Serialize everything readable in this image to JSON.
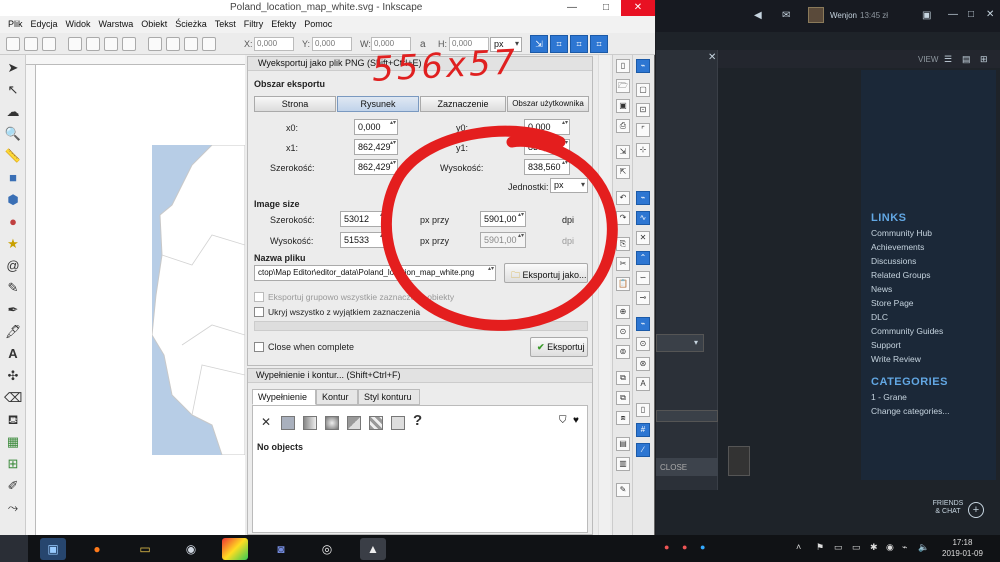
{
  "inkscape": {
    "title": "Poland_location_map_white.svg - Inkscape",
    "window_controls": [
      "—",
      "□",
      "✕"
    ],
    "menu": [
      "Plik",
      "Edycja",
      "Widok",
      "Warstwa",
      "Obiekt",
      "Ścieżka",
      "Tekst",
      "Filtry",
      "Efekty",
      "Pomoc"
    ],
    "toolbar": {
      "x_label": "X:",
      "x_value": "0,000",
      "y_label": "Y:",
      "y_value": "0,000",
      "w_label": "W:",
      "w_value": "0,000",
      "h_label": "H:",
      "h_value": "0,000",
      "lock_icon": "lock-icon",
      "unit": "px"
    }
  },
  "export_dialog": {
    "header": "Wyeksportuj jako plik PNG (Shift+Ctrl+E)",
    "area_title": "Obszar eksportu",
    "area_buttons": [
      "Strona",
      "Rysunek",
      "Zaznaczenie",
      "Obszar użytkownika"
    ],
    "active_area": "Rysunek",
    "x0_label": "x0:",
    "x0_value": "0,000",
    "y0_label": "y0:",
    "y0_value": "0,000",
    "x1_label": "x1:",
    "x1_value": "862,429",
    "y1_label": "y1:",
    "y1_value": "838,560",
    "width_label": "Szerokość:",
    "width_value": "862,429",
    "height_label": "Wysokość:",
    "height_value": "838,560",
    "units_label": "Jednostki:",
    "units_value": "px",
    "image_size_title": "Image size",
    "img_width_label": "Szerokość:",
    "img_width_value": "53012",
    "img_height_label": "Wysokość:",
    "img_height_value": "51533",
    "px_at_1": "px przy",
    "dpi_1_value": "5901,00",
    "dpi_1_label": "dpi",
    "px_at_2": "px przy",
    "dpi_2_value": "5901,00",
    "dpi_2_label": "dpi",
    "filename_title": "Nazwa pliku",
    "filename_value": "ctop\\Map Editor\\editor_data\\Poland_location_map_white.png",
    "export_as_label": "Eksportuj jako...",
    "batch_label": "Eksportuj grupowo wszystkie zaznaczone obiekty",
    "hide_label": "Ukryj wszystko z wyjątkiem zaznaczenia",
    "close_when_complete": "Close when complete",
    "export_button": "Eksportuj"
  },
  "fill_stroke": {
    "header": "Wypełnienie i kontur... (Shift+Ctrl+F)",
    "tabs": [
      "Wypełnienie",
      "Kontur",
      "Styl konturu"
    ],
    "no_objects": "No objects",
    "unknown_symbol": "?"
  },
  "annotation": {
    "text": "556x57"
  },
  "steam": {
    "username": "Wenjon",
    "time": "13:45 zł",
    "view_label": "VIEW",
    "close_label": "CLOSE",
    "links_header": "LINKS",
    "links": [
      "Community Hub",
      "Achievements",
      "Discussions",
      "Related Groups",
      "News",
      "Store Page",
      "DLC",
      "Community Guides",
      "Support",
      "Write Review"
    ],
    "categories_header": "CATEGORIES",
    "categories": [
      "1 - Grane",
      "Change categories..."
    ],
    "friends_chat": "FRIENDS\n& CHAT"
  },
  "taskbar": {
    "clock_time": "17:18",
    "clock_date": "2019-01-09",
    "apps": [
      "inkscape-icon",
      "firefox-icon",
      "explorer-icon",
      "steam-icon",
      "paint-icon",
      "discord-icon",
      "obs-icon",
      "inkscape-app-icon"
    ]
  }
}
